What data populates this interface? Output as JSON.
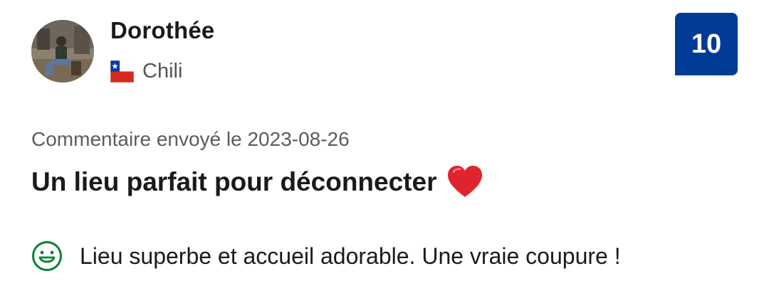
{
  "reviewer": {
    "name": "Dorothée",
    "country": "Chili",
    "flag_icon": "chile-flag-icon",
    "avatar_icon": "reviewer-avatar-photo"
  },
  "score": {
    "value": "10",
    "color": "#003b95"
  },
  "review": {
    "date_text": "Commentaire envoyé le 2023-08-26",
    "title": "Un lieu parfait pour déconnecter",
    "title_icon": "heart-icon",
    "positive_icon": "smile-icon",
    "positive_text": "Lieu superbe et accueil adorable. Une vraie coupure !"
  },
  "colors": {
    "positive_green": "#008234",
    "heart_red": "#e0242f",
    "badge_blue": "#003b95"
  }
}
